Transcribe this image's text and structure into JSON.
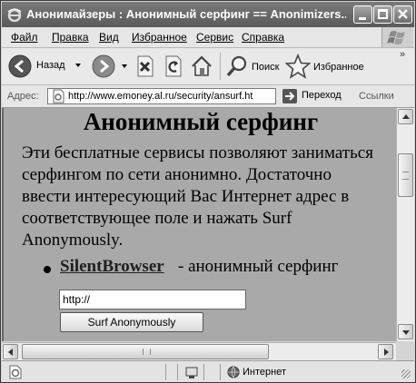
{
  "window": {
    "title": "Анонимайзеры : Анонимный серфинг == Anonimizers..."
  },
  "menu": {
    "items": [
      "Файл",
      "Правка",
      "Вид",
      "Избранное",
      "Сервис",
      "Справка"
    ]
  },
  "toolbar": {
    "back_label": "Назад",
    "search_label": "Поиск",
    "favorites_label": "Избранное"
  },
  "address": {
    "label": "Адрес:",
    "url": "http://www.emoney.al.ru/security/ansurf.ht",
    "go_label": "Переход",
    "links_label": "Ссылки"
  },
  "page": {
    "heading": "Анонимный серфинг",
    "paragraph": "Эти бесплатные сервисы позволяют заниматься серфингом по сети анонимно. Достаточно ввести интересующий Вас Интернет адрес в соответствующее поле и нажать Surf Anonymously.",
    "list": [
      {
        "link": "SilentBrowser",
        "desc": "- анонимный серфинг"
      }
    ],
    "url_input_value": "http://",
    "surf_button_label": "Surf Anonymously"
  },
  "status": {
    "zone": "Интернет"
  }
}
